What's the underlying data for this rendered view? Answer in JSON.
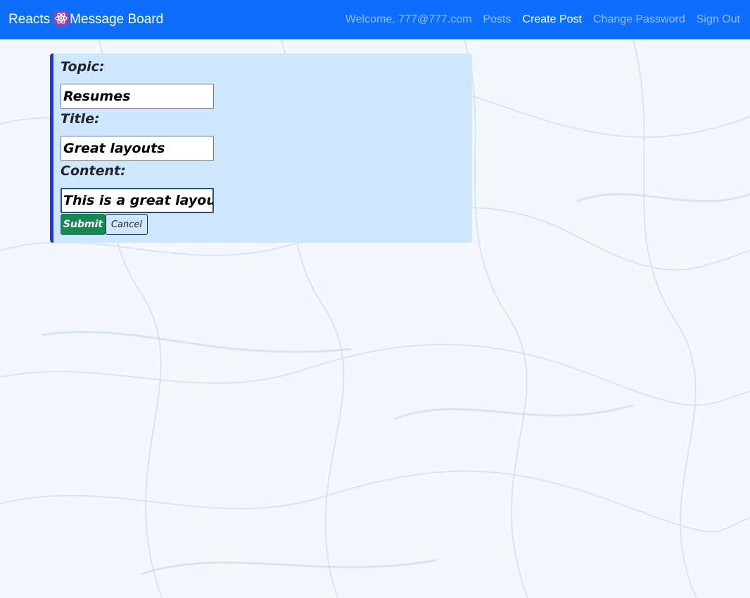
{
  "navbar": {
    "brand_prefix": "Reacts",
    "brand_icon": "atom-icon",
    "brand_suffix": "Message Board",
    "welcome": "Welcome, 777@777.com",
    "links": {
      "posts": "Posts",
      "create_post": "Create Post",
      "change_password": "Change Password",
      "sign_out": "Sign Out"
    },
    "active_link": "Create Post"
  },
  "form": {
    "topic_label": "Topic:",
    "topic_value": "Resumes",
    "title_label": "Title:",
    "title_value": "Great layouts",
    "content_label": "Content:",
    "content_value": "This is a great layout ",
    "submit_label": "Submit",
    "cancel_label": "Cancel"
  },
  "colors": {
    "navbar": "#0d6efd",
    "card": "#cfe7fd",
    "card_accent": "#1b37e6",
    "submit": "#198754"
  }
}
